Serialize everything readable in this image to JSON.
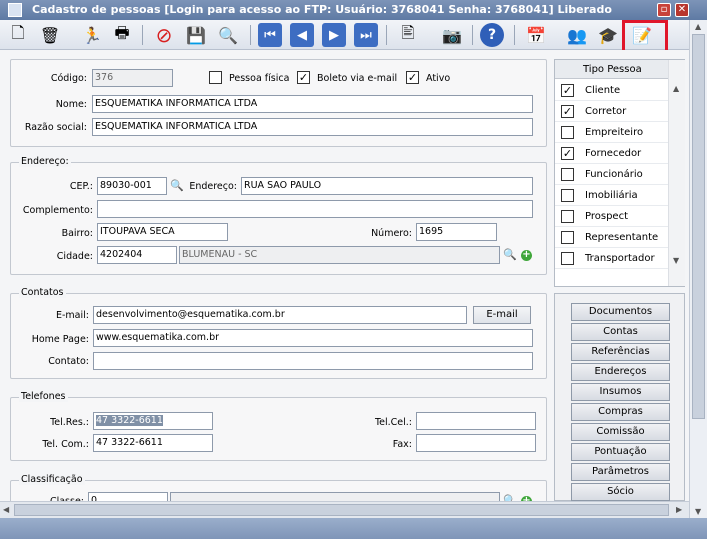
{
  "window": {
    "title": "Cadastro de pessoas [Login para acesso ao FTP: Usuário: 3768041 Senha: 3768041] Liberado"
  },
  "toolbar": {
    "icons": [
      "new-document-icon",
      "trash-icon",
      "run-icon",
      "printer-icon",
      "cancel-icon",
      "save-icon",
      "search-icon",
      "first-record-icon",
      "previous-record-icon",
      "next-record-icon",
      "last-record-icon",
      "report-icon",
      "camera-icon",
      "help-icon",
      "calendar-icon",
      "users-icon",
      "graduation-icon",
      "form-edit-icon"
    ]
  },
  "form": {
    "codigo_label": "Código:",
    "codigo_value": "376",
    "pessoa_fisica": {
      "label": "Pessoa física",
      "checked": false
    },
    "boleto_email": {
      "label": "Boleto via e-mail",
      "checked": true
    },
    "ativo": {
      "label": "Ativo",
      "checked": true
    },
    "nome_label": "Nome:",
    "nome_value": "ESQUEMATIKA INFORMATICA LTDA",
    "razao_label": "Razão social:",
    "razao_value": "ESQUEMATIKA INFORMATICA LTDA"
  },
  "endereco": {
    "title": "Endereço:",
    "cep_label": "CEP.:",
    "cep_value": "89030-001",
    "endereco_label": "Endereço:",
    "endereco_value": "RUA SAO PAULO",
    "complemento_label": "Complemento:",
    "complemento_value": "",
    "bairro_label": "Bairro:",
    "bairro_value": "ITOUPAVA SECA",
    "numero_label": "Número:",
    "numero_value": "1695",
    "cidade_label": "Cidade:",
    "cidade_code": "4202404",
    "cidade_name": "BLUMENAU - SC"
  },
  "contatos": {
    "title": "Contatos",
    "email_label": "E-mail:",
    "email_value": "desenvolvimento@esquematika.com.br",
    "email_button": "E-mail",
    "homepage_label": "Home Page:",
    "homepage_value": "www.esquematika.com.br",
    "contato_label": "Contato:",
    "contato_value": ""
  },
  "telefones": {
    "title": "Telefones",
    "telres_label": "Tel.Res.:",
    "telres_value": "47 3322-6611",
    "telcel_label": "Tel.Cel.:",
    "telcel_value": "",
    "telcom_label": "Tel. Com.:",
    "telcom_value": "47 3322-6611",
    "fax_label": "Fax:",
    "fax_value": ""
  },
  "classificacao": {
    "title": "Classificação",
    "classe_label": "Classe:",
    "classe_value": "0"
  },
  "tipo_pessoa": {
    "header": "Tipo Pessoa",
    "items": [
      {
        "label": "Cliente",
        "checked": true
      },
      {
        "label": "Corretor",
        "checked": true
      },
      {
        "label": "Empreiteiro",
        "checked": false
      },
      {
        "label": "Fornecedor",
        "checked": true
      },
      {
        "label": "Funcionário",
        "checked": false
      },
      {
        "label": "Imobiliária",
        "checked": false
      },
      {
        "label": "Prospect",
        "checked": false
      },
      {
        "label": "Representante",
        "checked": false
      },
      {
        "label": "Transportador",
        "checked": false
      }
    ]
  },
  "side_buttons": [
    "Documentos",
    "Contas",
    "Referências",
    "Endereços",
    "Insumos",
    "Compras",
    "Comissão",
    "Pontuação",
    "Parâmetros",
    "Sócio"
  ],
  "colors": {
    "highlight": "#e0162a",
    "titlebar": "#6d86ae"
  }
}
